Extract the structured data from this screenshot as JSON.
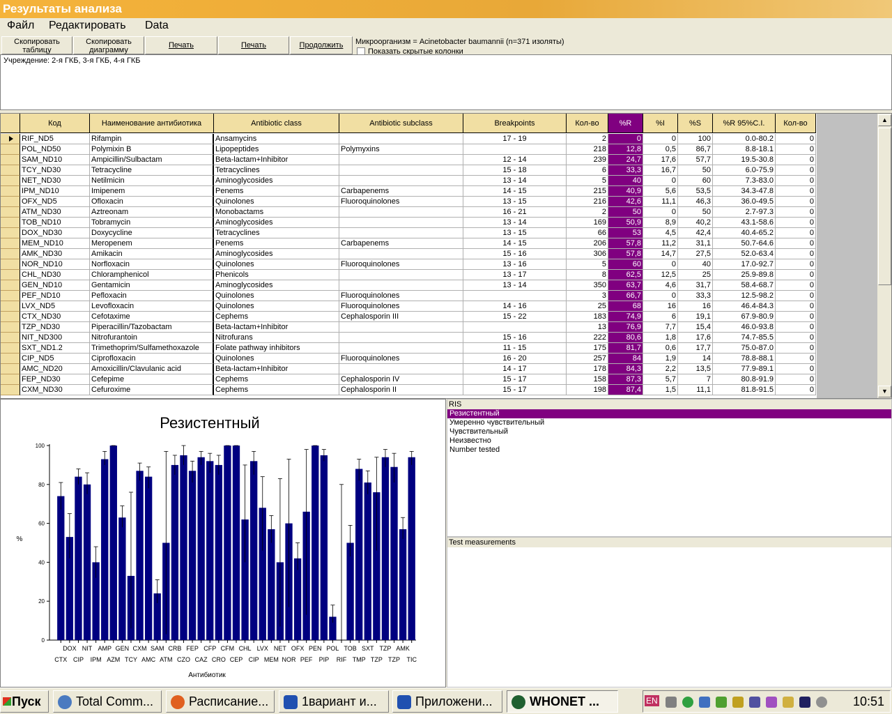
{
  "window": {
    "title": "Результаты анализа"
  },
  "menu": [
    "Файл",
    "Редактировать",
    "Data"
  ],
  "toolbar": {
    "copy_table": "Скопировать таблицу",
    "copy_chart": "Скопировать диаграмму",
    "print1": "Печать",
    "print2": "Печать",
    "continue": "Продолжить",
    "organism": "Микроорганизм = Acinetobacter baumannii   (n=371 изоляты)",
    "show_hidden": "Показать скрытые колонки"
  },
  "institution": "Учреждение:   2-я ГКБ, 3-я ГКБ, 4-я ГКБ",
  "grid": {
    "columns": [
      "Код",
      "Наименование антибиотика",
      "Antibiotic class",
      "Antibiotic subclass",
      "Breakpoints",
      "Кол-во",
      "%R",
      "%I",
      "%S",
      "%R 95%C.I.",
      "Кол-во"
    ],
    "rows": [
      [
        "RIF_ND5",
        "Rifampin",
        "Ansamycins",
        "",
        "17 - 19",
        "2",
        "0",
        "0",
        "100",
        "0.0-80.2",
        "0"
      ],
      [
        "POL_ND50",
        "Polymixin B",
        "Lipopeptides",
        "Polymyxins",
        "",
        "218",
        "12,8",
        "0,5",
        "86,7",
        "8.8-18.1",
        "0"
      ],
      [
        "SAM_ND10",
        "Ampicillin/Sulbactam",
        "Beta-lactam+Inhibitor",
        "",
        "12 - 14",
        "239",
        "24,7",
        "17,6",
        "57,7",
        "19.5-30.8",
        "0"
      ],
      [
        "TCY_ND30",
        "Tetracycline",
        "Tetracyclines",
        "",
        "15 - 18",
        "6",
        "33,3",
        "16,7",
        "50",
        "6.0-75.9",
        "0"
      ],
      [
        "NET_ND30",
        "Netilmicin",
        "Aminoglycosides",
        "",
        "13 - 14",
        "5",
        "40",
        "0",
        "60",
        "7.3-83.0",
        "0"
      ],
      [
        "IPM_ND10",
        "Imipenem",
        "Penems",
        "Carbapenems",
        "14 - 15",
        "215",
        "40,9",
        "5,6",
        "53,5",
        "34.3-47.8",
        "0"
      ],
      [
        "OFX_ND5",
        "Ofloxacin",
        "Quinolones",
        "Fluoroquinolones",
        "13 - 15",
        "216",
        "42,6",
        "11,1",
        "46,3",
        "36.0-49.5",
        "0"
      ],
      [
        "ATM_ND30",
        "Aztreonam",
        "Monobactams",
        "",
        "16 - 21",
        "2",
        "50",
        "0",
        "50",
        "2.7-97.3",
        "0"
      ],
      [
        "TOB_ND10",
        "Tobramycin",
        "Aminoglycosides",
        "",
        "13 - 14",
        "169",
        "50,9",
        "8,9",
        "40,2",
        "43.1-58.6",
        "0"
      ],
      [
        "DOX_ND30",
        "Doxycycline",
        "Tetracyclines",
        "",
        "13 - 15",
        "66",
        "53",
        "4,5",
        "42,4",
        "40.4-65.2",
        "0"
      ],
      [
        "MEM_ND10",
        "Meropenem",
        "Penems",
        "Carbapenems",
        "14 - 15",
        "206",
        "57,8",
        "11,2",
        "31,1",
        "50.7-64.6",
        "0"
      ],
      [
        "AMK_ND30",
        "Amikacin",
        "Aminoglycosides",
        "",
        "15 - 16",
        "306",
        "57,8",
        "14,7",
        "27,5",
        "52.0-63.4",
        "0"
      ],
      [
        "NOR_ND10",
        "Norfloxacin",
        "Quinolones",
        "Fluoroquinolones",
        "13 - 16",
        "5",
        "60",
        "0",
        "40",
        "17.0-92.7",
        "0"
      ],
      [
        "CHL_ND30",
        "Chloramphenicol",
        "Phenicols",
        "",
        "13 - 17",
        "8",
        "62,5",
        "12,5",
        "25",
        "25.9-89.8",
        "0"
      ],
      [
        "GEN_ND10",
        "Gentamicin",
        "Aminoglycosides",
        "",
        "13 - 14",
        "350",
        "63,7",
        "4,6",
        "31,7",
        "58.4-68.7",
        "0"
      ],
      [
        "PEF_ND10",
        "Pefloxacin",
        "Quinolones",
        "Fluoroquinolones",
        "",
        "3",
        "66,7",
        "0",
        "33,3",
        "12.5-98.2",
        "0"
      ],
      [
        "LVX_ND5",
        "Levofloxacin",
        "Quinolones",
        "Fluoroquinolones",
        "14 - 16",
        "25",
        "68",
        "16",
        "16",
        "46.4-84.3",
        "0"
      ],
      [
        "CTX_ND30",
        "Cefotaxime",
        "Cephems",
        "Cephalosporin III",
        "15 - 22",
        "183",
        "74,9",
        "6",
        "19,1",
        "67.9-80.9",
        "0"
      ],
      [
        "TZP_ND30",
        "Piperacillin/Tazobactam",
        "Beta-lactam+Inhibitor",
        "",
        "",
        "13",
        "76,9",
        "7,7",
        "15,4",
        "46.0-93.8",
        "0"
      ],
      [
        "NIT_ND300",
        "Nitrofurantoin",
        "Nitrofurans",
        "",
        "15 - 16",
        "222",
        "80,6",
        "1,8",
        "17,6",
        "74.7-85.5",
        "0"
      ],
      [
        "SXT_ND1.2",
        "Trimethoprim/Sulfamethoxazole",
        "Folate pathway inhibitors",
        "",
        "11 - 15",
        "175",
        "81,7",
        "0,6",
        "17,7",
        "75.0-87.0",
        "0"
      ],
      [
        "CIP_ND5",
        "Ciprofloxacin",
        "Quinolones",
        "Fluoroquinolones",
        "16 - 20",
        "257",
        "84",
        "1,9",
        "14",
        "78.8-88.1",
        "0"
      ],
      [
        "AMC_ND20",
        "Amoxicillin/Clavulanic acid",
        "Beta-lactam+Inhibitor",
        "",
        "14 - 17",
        "178",
        "84,3",
        "2,2",
        "13,5",
        "77.9-89.1",
        "0"
      ],
      [
        "FEP_ND30",
        "Cefepime",
        "Cephems",
        "Cephalosporin IV",
        "15 - 17",
        "158",
        "87,3",
        "5,7",
        "7",
        "80.8-91.9",
        "0"
      ],
      [
        "CXM_ND30",
        "Cefuroxime",
        "Cephems",
        "Cephalosporin II",
        "15 - 17",
        "198",
        "87,4",
        "1,5",
        "11,1",
        "81.8-91.5",
        "0"
      ]
    ]
  },
  "chart_data": {
    "type": "bar",
    "title": "Резистентный",
    "xlabel": "Антибиотик",
    "ylabel": "%",
    "ylim": [
      0,
      100
    ],
    "yticks": [
      0,
      20,
      40,
      60,
      80,
      100
    ],
    "categories": [
      "CTX",
      "DOX",
      "CIP",
      "NIT",
      "IPM",
      "AMP",
      "AZM",
      "GEN",
      "TCY",
      "CXM",
      "AMC",
      "SAM",
      "ATM",
      "CRB",
      "CZO",
      "FEP",
      "CAZ",
      "CFP",
      "CRO",
      "CFM",
      "CEP",
      "CHL",
      "CIP",
      "LVX",
      "MEM",
      "NET",
      "NOR",
      "OFX",
      "PEF",
      "PEN",
      "PIP",
      "POL",
      "RIF",
      "TOB",
      "TMP",
      "SXT",
      "TZP",
      "TZP",
      "TZP",
      "AMK",
      "TIC"
    ],
    "values": [
      74,
      53,
      84,
      80,
      40,
      93,
      100,
      63,
      33,
      87,
      84,
      24,
      50,
      90,
      95,
      87,
      94,
      92,
      90,
      100,
      100,
      62,
      92,
      68,
      57,
      40,
      60,
      42,
      66,
      100,
      95,
      12,
      0,
      50,
      88,
      81,
      76,
      94,
      89,
      57,
      94
    ],
    "err_low": [
      67,
      42,
      80,
      75,
      32,
      90,
      100,
      58,
      6,
      82,
      78,
      19,
      3,
      85,
      90,
      81,
      90,
      86,
      85,
      100,
      100,
      40,
      85,
      46,
      50,
      7,
      17,
      36,
      13,
      100,
      92,
      9,
      0,
      43,
      82,
      75,
      46,
      89,
      81,
      52,
      90
    ],
    "err_high": [
      81,
      65,
      88,
      86,
      48,
      97,
      100,
      69,
      76,
      91,
      89,
      31,
      97,
      95,
      100,
      92,
      97,
      96,
      95,
      100,
      100,
      90,
      97,
      84,
      64,
      83,
      93,
      50,
      98,
      100,
      98,
      18,
      80,
      59,
      93,
      87,
      94,
      98,
      96,
      63,
      97
    ],
    "bar_color": "#000080"
  },
  "ris": {
    "header": "RIS",
    "items": [
      "Резистентный",
      "Умеренно чувствительный",
      "Чувствительный",
      "Неизвестно",
      "Number tested"
    ]
  },
  "test_measurements": {
    "header": "Test measurements"
  },
  "taskbar": {
    "start": "Пуск",
    "items": [
      "Total Comm...",
      "Расписание...",
      "1вариант  и...",
      "Приложени...",
      "WHONET ..."
    ],
    "tray_lang": "EN",
    "clock": "10:51"
  }
}
